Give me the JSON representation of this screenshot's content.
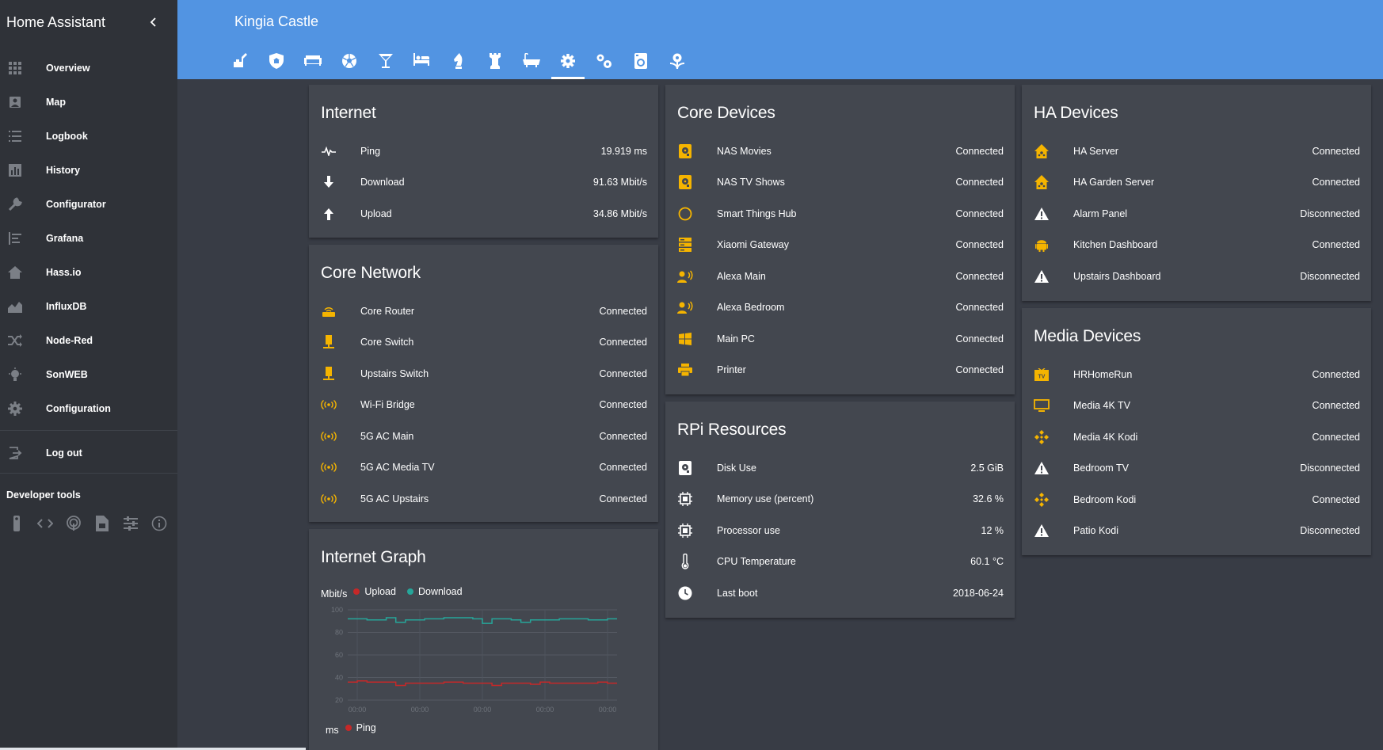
{
  "sidebar": {
    "title": "Home Assistant",
    "items": [
      {
        "label": "Overview",
        "icon": "grid-icon"
      },
      {
        "label": "Map",
        "icon": "map-icon"
      },
      {
        "label": "Logbook",
        "icon": "list-icon"
      },
      {
        "label": "History",
        "icon": "chart-icon"
      },
      {
        "label": "Configurator",
        "icon": "wrench-icon"
      },
      {
        "label": "Grafana",
        "icon": "sort-icon"
      },
      {
        "label": "Hass.io",
        "icon": "home-icon"
      },
      {
        "label": "InfluxDB",
        "icon": "area-chart-icon"
      },
      {
        "label": "Node-Red",
        "icon": "shuffle-icon"
      },
      {
        "label": "SonWEB",
        "icon": "bulb-icon"
      },
      {
        "label": "Configuration",
        "icon": "gear-icon"
      }
    ],
    "logout": "Log out",
    "developer_tools_title": "Developer tools",
    "developer_tools": [
      "remote-icon",
      "code-icon",
      "podcast-icon",
      "file-icon",
      "tune-icon",
      "info-icon"
    ]
  },
  "header": {
    "title": "Kingia Castle",
    "tabs": [
      "crane-icon",
      "shield-home-icon",
      "sofa-icon",
      "soccer-icon",
      "martini-icon",
      "bed-icon",
      "chess-knight-icon",
      "chess-rook-icon",
      "bathtub-icon",
      "settings-icon",
      "settings-multiple-icon",
      "washing-machine-icon",
      "flower-icon"
    ],
    "active_tab": 9
  },
  "accent": "#f5b400",
  "internet": {
    "title": "Internet",
    "rows": [
      {
        "name": "Ping",
        "state": "19.919 ms",
        "icon": "pulse-icon"
      },
      {
        "name": "Download",
        "state": "91.63 Mbit/s",
        "icon": "arrow-down-icon"
      },
      {
        "name": "Upload",
        "state": "34.86 Mbit/s",
        "icon": "arrow-up-icon"
      }
    ]
  },
  "core_network": {
    "title": "Core Network",
    "rows": [
      {
        "name": "Core Router",
        "state": "Connected",
        "icon": "router-icon"
      },
      {
        "name": "Core Switch",
        "state": "Connected",
        "icon": "switch-icon"
      },
      {
        "name": "Upstairs Switch",
        "state": "Connected",
        "icon": "switch-icon"
      },
      {
        "name": "Wi-Fi Bridge",
        "state": "Connected",
        "icon": "wifi-signal-icon"
      },
      {
        "name": "5G AC Main",
        "state": "Connected",
        "icon": "wifi-signal-icon"
      },
      {
        "name": "5G AC Media TV",
        "state": "Connected",
        "icon": "wifi-signal-icon"
      },
      {
        "name": "5G AC Upstairs",
        "state": "Connected",
        "icon": "wifi-signal-icon"
      }
    ]
  },
  "internet_graph": {
    "title": "Internet Graph",
    "unit": "Mbit/s",
    "legend_upload": "Upload",
    "legend_download": "Download",
    "upload_color": "#c62828",
    "download_color": "#26a69a",
    "ping_unit": "ms",
    "legend_ping": "Ping"
  },
  "chart_data": {
    "type": "line",
    "ylim": [
      20,
      100
    ],
    "y_ticks": [
      "100",
      "80",
      "60",
      "40",
      "20"
    ],
    "x_ticks": [
      "00:00",
      "00:00",
      "00:00",
      "00:00",
      "00:00"
    ],
    "series": [
      {
        "name": "Download",
        "values": [
          92,
          92,
          91,
          91,
          93,
          89,
          91,
          91,
          92,
          92,
          93,
          93,
          93,
          92,
          88,
          92,
          92,
          91,
          89,
          91,
          91,
          91,
          92,
          92,
          92,
          91,
          91,
          92
        ]
      },
      {
        "name": "Upload",
        "values": [
          36,
          37,
          36,
          36,
          36,
          33,
          35,
          35,
          35,
          35,
          36,
          36,
          35,
          35,
          35,
          33,
          35,
          35,
          35,
          34,
          36,
          35,
          35,
          35,
          35,
          35,
          36,
          35
        ]
      }
    ]
  },
  "core_devices": {
    "title": "Core Devices",
    "rows": [
      {
        "name": "NAS Movies",
        "state": "Connected",
        "icon": "harddisk-icon"
      },
      {
        "name": "NAS TV Shows",
        "state": "Connected",
        "icon": "harddisk-icon"
      },
      {
        "name": "Smart Things Hub",
        "state": "Connected",
        "icon": "circle-icon"
      },
      {
        "name": "Xiaomi Gateway",
        "state": "Connected",
        "icon": "server-icon"
      },
      {
        "name": "Alexa Main",
        "state": "Connected",
        "icon": "voice-icon"
      },
      {
        "name": "Alexa Bedroom",
        "state": "Connected",
        "icon": "voice-icon"
      },
      {
        "name": "Main PC",
        "state": "Connected",
        "icon": "windows-icon"
      },
      {
        "name": "Printer",
        "state": "Connected",
        "icon": "printer-icon"
      }
    ]
  },
  "rpi": {
    "title": "RPi Resources",
    "rows": [
      {
        "name": "Disk Use",
        "state": "2.5 GiB",
        "icon": "harddisk-icon"
      },
      {
        "name": "Memory use (percent)",
        "state": "32.6 %",
        "icon": "chip-icon"
      },
      {
        "name": "Processor use",
        "state": "12 %",
        "icon": "chip-icon"
      },
      {
        "name": "CPU Temperature",
        "state": "60.1 °C",
        "icon": "thermometer-icon"
      },
      {
        "name": "Last boot",
        "state": "2018-06-24",
        "icon": "clock-icon"
      }
    ]
  },
  "ha_devices": {
    "title": "HA Devices",
    "rows": [
      {
        "name": "HA Server",
        "state": "Connected",
        "icon": "home-assistant-icon"
      },
      {
        "name": "HA Garden Server",
        "state": "Connected",
        "icon": "home-assistant-icon"
      },
      {
        "name": "Alarm Panel",
        "state": "Disconnected",
        "icon": "alert-icon"
      },
      {
        "name": "Kitchen Dashboard",
        "state": "Connected",
        "icon": "android-icon"
      },
      {
        "name": "Upstairs Dashboard",
        "state": "Disconnected",
        "icon": "alert-icon"
      }
    ]
  },
  "media_devices": {
    "title": "Media Devices",
    "rows": [
      {
        "name": "HRHomeRun",
        "state": "Connected",
        "icon": "tv-box-icon"
      },
      {
        "name": "Media 4K TV",
        "state": "Connected",
        "icon": "monitor-icon"
      },
      {
        "name": "Media 4K Kodi",
        "state": "Connected",
        "icon": "kodi-icon"
      },
      {
        "name": "Bedroom TV",
        "state": "Disconnected",
        "icon": "alert-icon"
      },
      {
        "name": "Bedroom Kodi",
        "state": "Connected",
        "icon": "kodi-icon"
      },
      {
        "name": "Patio Kodi",
        "state": "Disconnected",
        "icon": "alert-icon"
      }
    ]
  }
}
